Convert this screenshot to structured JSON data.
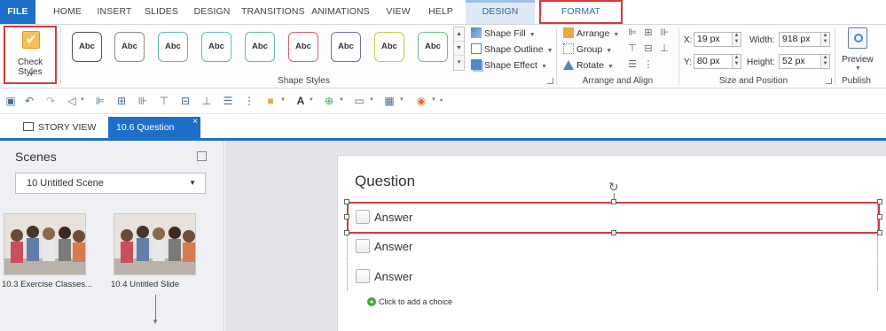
{
  "tabs": [
    "FILE",
    "HOME",
    "INSERT",
    "SLIDES",
    "DESIGN",
    "TRANSITIONS",
    "ANIMATIONS",
    "VIEW",
    "HELP",
    "DESIGN",
    "FORMAT"
  ],
  "ribbon": {
    "check_styles_label": "Check Styles",
    "style_sample": "Abc",
    "shape_styles_label": "Shape Styles",
    "shape_fill": "Shape Fill",
    "shape_outline": "Shape Outline",
    "shape_effect": "Shape Effect",
    "arrange": "Arrange",
    "group": "Group",
    "rotate": "Rotate",
    "arrange_align_label": "Arrange and Align",
    "x_label": "X:",
    "x_value": "19 px",
    "y_label": "Y:",
    "y_value": "80 px",
    "width_label": "Width:",
    "width_value": "918 px",
    "height_label": "Height:",
    "height_value": "52 px",
    "size_position_label": "Size and Position",
    "preview": "Preview",
    "publish_label": "Publish"
  },
  "view_tabs": {
    "story_view": "STORY VIEW",
    "question": "10.6 Question",
    "close": "×"
  },
  "scenes": {
    "title": "Scenes",
    "selected_scene": "10 Untitled Scene",
    "thumbnails": [
      {
        "label": "10.3 Exercise Classes..."
      },
      {
        "label": "10.4 Untitled Slide"
      }
    ]
  },
  "slide": {
    "title": "Question",
    "answers": [
      "Answer",
      "Answer",
      "Answer"
    ],
    "add_choice": "Click to add a choice"
  },
  "colors": {
    "file_tab": "#1e6fc8",
    "highlight_red": "#d33a3a",
    "style_borders": [
      "#555555",
      "#8c8c8c",
      "#63b8b2",
      "#68b7c9",
      "#66bf8e",
      "#d85b6a",
      "#7a6bb3",
      "#c3cd4a",
      "#6fc08f"
    ]
  }
}
